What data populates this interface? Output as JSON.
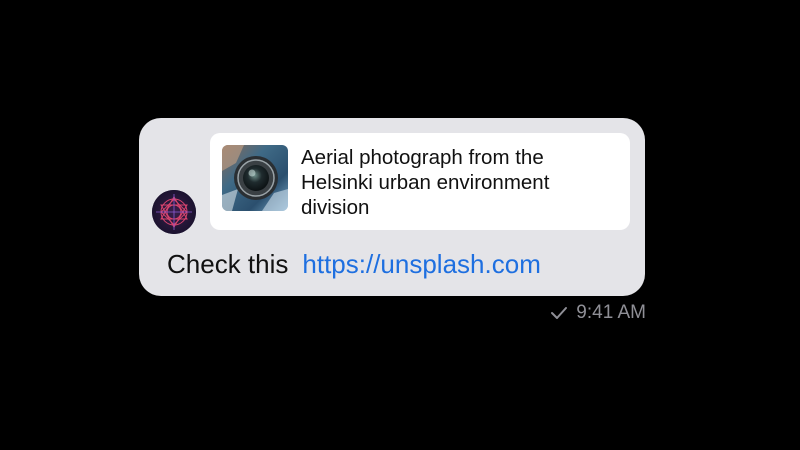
{
  "message": {
    "text": "Check this",
    "link": "https://unsplash.com",
    "time": "9:41 AM",
    "status_icon": "check-icon",
    "avatar_icon": "geometric-avatar-icon"
  },
  "preview": {
    "title": "Aerial photograph from the Helsinki urban environment division",
    "thumbnail_icon": "camera-lens-thumbnail"
  },
  "colors": {
    "background": "#000000",
    "bubble": "#e4e4e8",
    "card": "#ffffff",
    "link": "#1e6fe0",
    "meta": "#8f8f96"
  }
}
